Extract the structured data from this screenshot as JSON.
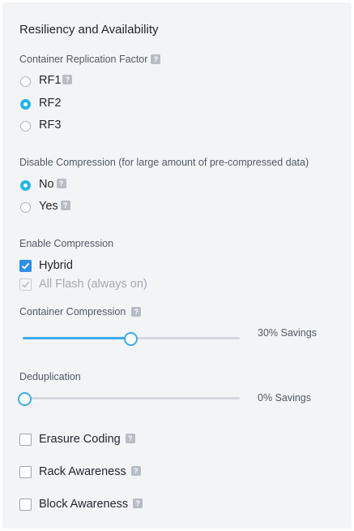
{
  "panel": {
    "title": "Resiliency and Availability"
  },
  "replication": {
    "label": "Container Replication Factor",
    "options": [
      {
        "label": "RF1",
        "checked": false,
        "help": "?"
      },
      {
        "label": "RF2",
        "checked": true
      },
      {
        "label": "RF3",
        "checked": false
      }
    ]
  },
  "disable_compression": {
    "label": "Disable Compression (for large amount of pre-compressed data)",
    "options": [
      {
        "label": "No",
        "checked": true,
        "help": "?"
      },
      {
        "label": "Yes",
        "checked": false,
        "help": "?"
      }
    ]
  },
  "enable_compression": {
    "label": "Enable Compression",
    "options": [
      {
        "label": "Hybrid",
        "checked": true,
        "disabled": false
      },
      {
        "label": "All Flash (always on)",
        "checked": true,
        "disabled": true
      }
    ]
  },
  "container_compression": {
    "label": "Container Compression",
    "value_text": "30% Savings",
    "level": 0.5
  },
  "deduplication": {
    "label": "Deduplication",
    "value_text": "0% Savings",
    "level": 0
  },
  "toggles": [
    {
      "label": "Erasure Coding",
      "checked": false
    },
    {
      "label": "Rack Awareness",
      "checked": false
    },
    {
      "label": "Block Awareness",
      "checked": false
    }
  ],
  "help_glyph": "?",
  "colors": {
    "accent": "#26b6e7",
    "slider": "#3cace8",
    "checkbox": "#2f8fe8",
    "panel_bg": "#f3f4f6"
  }
}
